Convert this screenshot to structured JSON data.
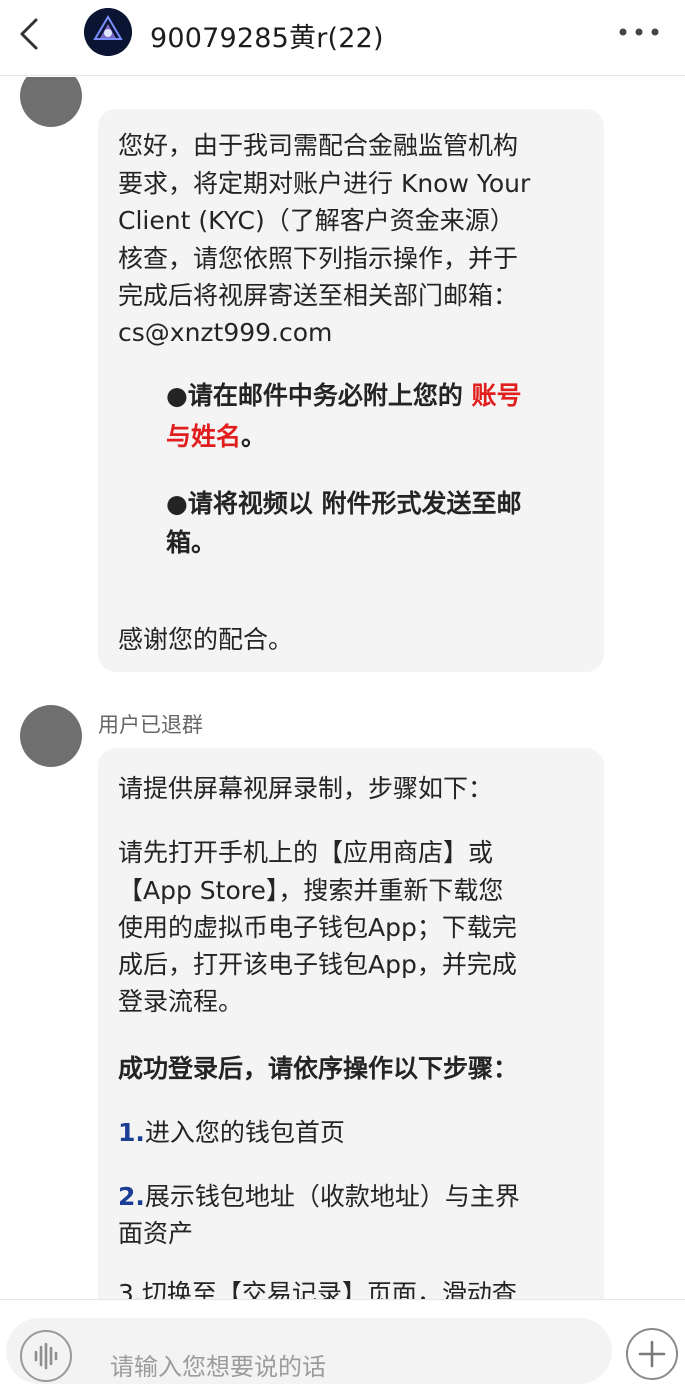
{
  "header": {
    "title": "90079285黄r(22)"
  },
  "messages": [
    {
      "lines": [
        "您好，由于我司需配合金融监管机构",
        "要求，将定期对账户进行 Know Your",
        "Client (KYC)（了解客户资金来源）",
        "核查，请您依照下列指示操作，并于",
        "完成后将视屏寄送至相关部门邮箱：",
        "cs@xnzt999.com"
      ],
      "bullet1_a": "●请在邮件中务必附上您的",
      "bullet1_red_a": "账号",
      "bullet1_red_b": "与姓名",
      "bullet1_end": "。",
      "bullet2_a": "●请将视频以 附件形式发送至邮",
      "bullet2_b": "箱。",
      "thanks": "感谢您的配合。"
    },
    {
      "sender": "用户已退群",
      "intro": "请提供屏幕视屏录制，步骤如下：",
      "para": [
        "请先打开手机上的【应用商店】或",
        "【App Store】，搜索并重新下载您",
        "使用的虚拟币电子钱包App；下载完",
        "成后，打开该电子钱包App，并完成",
        "登录流程。"
      ],
      "steps_title": "成功登录后，请依序操作以下步骤：",
      "step1_num": "1.",
      "step1": "进入您的钱包首页",
      "step2_num": "2.",
      "step2_a": "展示钱包地址（收款地址）与主界",
      "step2_b": "面资产",
      "step3_partial": "3.切换至【交易记录】页面，滑动查"
    }
  ],
  "input": {
    "placeholder": "请输入您想要说的话"
  }
}
